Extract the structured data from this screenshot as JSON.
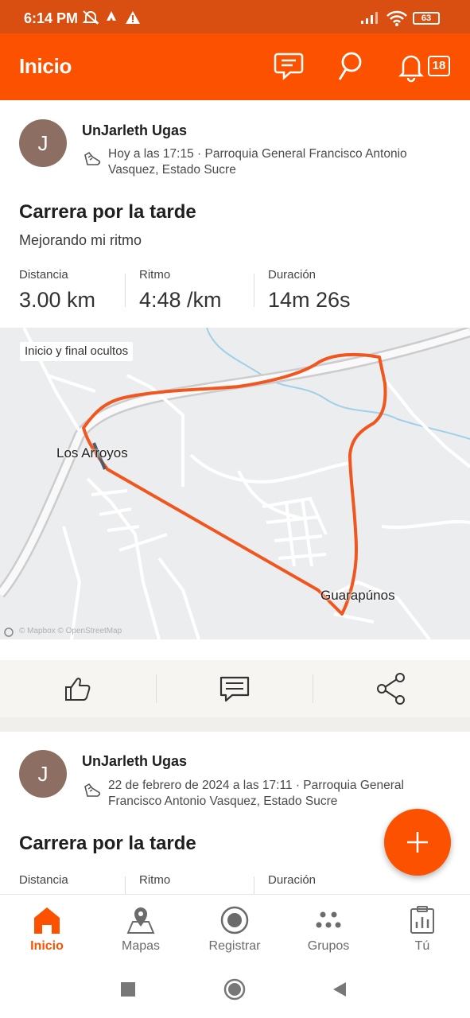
{
  "status_bar": {
    "time": "6:14 PM",
    "battery": "63"
  },
  "app_bar": {
    "title": "Inicio",
    "notification_count": "18"
  },
  "feed": [
    {
      "avatar_initial": "J",
      "athlete_name": "UnJarleth Ugas",
      "meta_line1": "Hoy a las 17:15 · Parroquia General Francisco Antonio",
      "meta_line2": "Vasquez, Estado Sucre",
      "title": "Carrera por la tarde",
      "description": "Mejorando mi ritmo",
      "stats": [
        {
          "label": "Distancia",
          "value": "3.00 km"
        },
        {
          "label": "Ritmo",
          "value": "4:48 /km"
        },
        {
          "label": "Duración",
          "value": "14m 26s"
        }
      ],
      "map": {
        "chip": "Inicio y final ocultos",
        "place_1": "Los Arroyos",
        "place_2": "Guarapúnos",
        "attribution": "© Mapbox © OpenStreetMap"
      }
    },
    {
      "avatar_initial": "J",
      "athlete_name": "UnJarleth Ugas",
      "meta_line1": "22 de febrero de 2024 a las 17:11 · Parroquia General",
      "meta_line2": "Francisco Antonio Vasquez, Estado Sucre",
      "title": "Carrera por la tarde",
      "stats": [
        {
          "label": "Distancia"
        },
        {
          "label": "Ritmo"
        },
        {
          "label": "Duración"
        }
      ]
    }
  ],
  "bottom_nav": [
    {
      "label": "Inicio",
      "active": true
    },
    {
      "label": "Mapas"
    },
    {
      "label": "Registrar"
    },
    {
      "label": "Grupos"
    },
    {
      "label": "Tú"
    }
  ],
  "colors": {
    "brand": "#fc5200",
    "status_bar": "#d94f12",
    "route": "#f0561d"
  }
}
